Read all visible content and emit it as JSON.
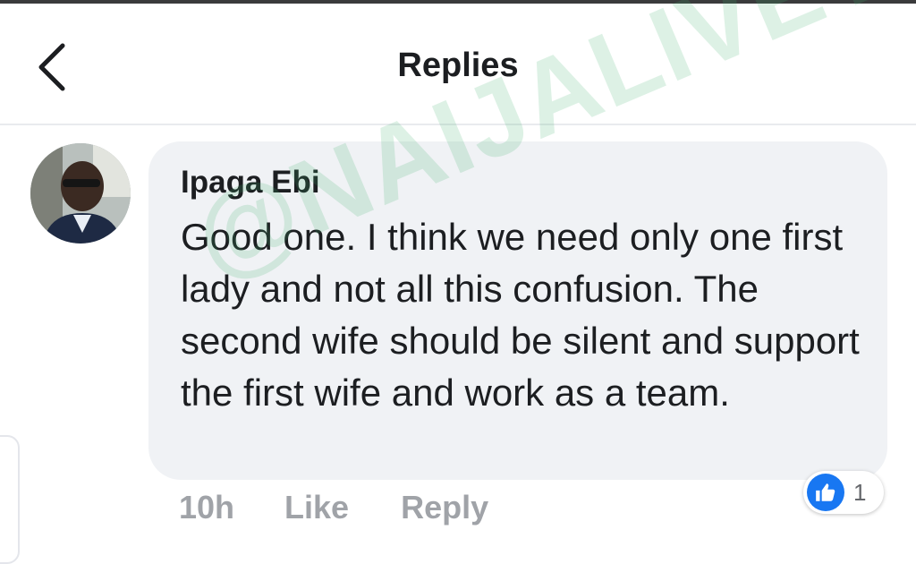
{
  "header": {
    "title": "Replies",
    "back_icon": "chevron-left-icon"
  },
  "comment": {
    "author": "Ipaga Ebi",
    "text": "Good one. I think we need only one first lady and not all this confusion. The second wife should be silent and support the first wife and work as a team.",
    "avatar_icon": "user-avatar"
  },
  "meta": {
    "time": "10h",
    "like_label": "Like",
    "reply_label": "Reply"
  },
  "reactions": {
    "icon": "thumbs-up-icon",
    "count": "1"
  },
  "watermark": {
    "text": "@NAIJALIVETV"
  },
  "colors": {
    "accent": "#1877f2",
    "bubble": "#f0f2f5",
    "meta_text": "#a0a3a8"
  }
}
